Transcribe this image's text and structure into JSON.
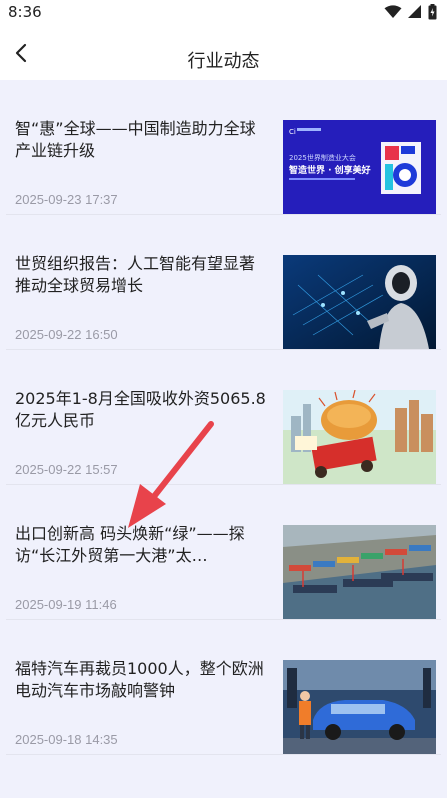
{
  "status_bar": {
    "time": "8:36"
  },
  "header": {
    "title": "行业动态"
  },
  "news": [
    {
      "title": "智“惠”全球——中国制造助力全球产业链升级",
      "date": "2025-09-23 17:37",
      "image": "expo-banner"
    },
    {
      "title": "世贸组织报告：人工智能有望显著推动全球贸易增长",
      "date": "2025-09-22 16:50",
      "image": "ai-robot"
    },
    {
      "title": "2025年1-8月全国吸收外资5065.8亿元人民币",
      "date": "2025-09-22 15:57",
      "image": "investment-cartoon"
    },
    {
      "title": "出口创新高 码头焕新“绿”——探访“长江外贸第一大港”太…",
      "date": "2025-09-19 11:46",
      "image": "port-aerial"
    },
    {
      "title": "福特汽车再裁员1000人，整个欧洲电动汽车市场敲响警钟",
      "date": "2025-09-18 14:35",
      "image": "car-factory"
    }
  ],
  "thumbs": {
    "expo_sub": "智造世界 · 创享美好"
  },
  "colors": {
    "background": "#f0f1fc",
    "header": "#ffffff",
    "date": "#9a9aa6",
    "arrow": "#e8434b"
  }
}
